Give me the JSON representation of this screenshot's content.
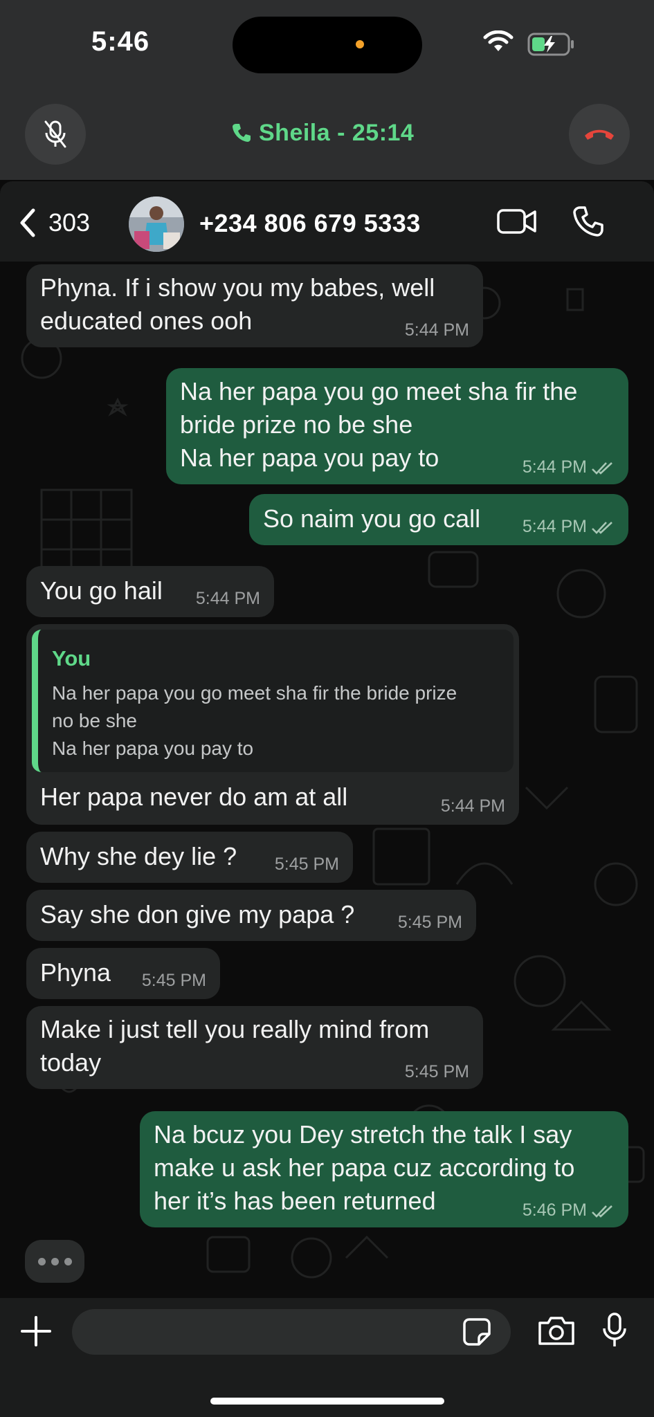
{
  "status_bar": {
    "time": "5:46"
  },
  "call": {
    "title": "Sheila - 25:14"
  },
  "header": {
    "back_count": "303",
    "contact_number": "+234 806 679 5333"
  },
  "messages": [
    {
      "direction": "in",
      "lines": [
        "Phyna. If i show you my babes, well",
        "educated ones ooh"
      ],
      "time": "5:44 PM"
    },
    {
      "direction": "out",
      "lines": [
        "Na her papa you go meet sha fir the",
        "bride prize no be she",
        "Na her papa you pay to"
      ],
      "time": "5:44 PM"
    },
    {
      "direction": "out",
      "lines": [
        "So naim you go call"
      ],
      "time": "5:44 PM"
    },
    {
      "direction": "in",
      "lines": [
        "You go hail"
      ],
      "time": "5:44 PM"
    },
    {
      "direction": "in",
      "quote": {
        "author": "You",
        "lines": [
          "Na her papa you go meet sha fir the bride prize",
          "no be she",
          "Na her papa you pay to"
        ]
      },
      "lines": [
        "Her papa never do am at all"
      ],
      "time": "5:44 PM"
    },
    {
      "direction": "in",
      "lines": [
        "Why she dey lie ?"
      ],
      "time": "5:45 PM"
    },
    {
      "direction": "in",
      "lines": [
        "Say she don give my papa ?"
      ],
      "time": "5:45 PM"
    },
    {
      "direction": "in",
      "lines": [
        "Phyna"
      ],
      "time": "5:45 PM"
    },
    {
      "direction": "in",
      "lines": [
        "Make i just tell you really mind from",
        "today"
      ],
      "time": "5:45 PM"
    },
    {
      "direction": "out",
      "lines": [
        "Na bcuz you Dey stretch the talk I say",
        "make u ask her papa cuz according to",
        "her it’s has been returned"
      ],
      "time": "5:46 PM"
    }
  ],
  "colors": {
    "outgoing_bubble": "#1f5c3f",
    "incoming_bubble": "#242626",
    "accent_green": "#5fd889",
    "end_call_red": "#e5453b"
  },
  "icons": [
    "mic-off-icon",
    "phone-icon",
    "end-call-icon",
    "chevron-left-icon",
    "video-icon",
    "plus-icon",
    "sticker-icon",
    "camera-icon",
    "microphone-icon",
    "read-ticks-icon"
  ]
}
